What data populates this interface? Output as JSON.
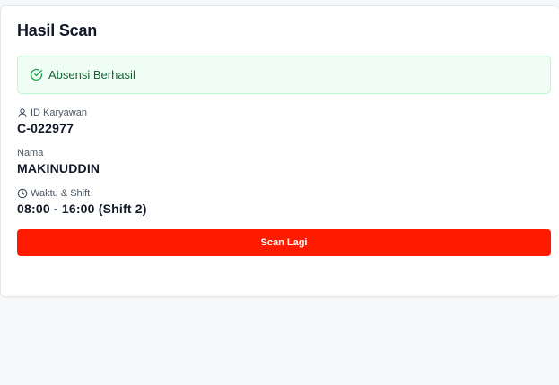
{
  "card": {
    "title": "Hasil Scan"
  },
  "alert": {
    "icon": "check-circle-icon",
    "message": "Absensi Berhasil",
    "color": "#166534",
    "background": "#f0fdf4"
  },
  "fields": {
    "id": {
      "icon": "user-icon",
      "label": "ID Karyawan",
      "value": "C-022977"
    },
    "nama": {
      "label": "Nama",
      "value": "MAKINUDDIN"
    },
    "waktu": {
      "icon": "clock-icon",
      "label": "Waktu & Shift",
      "value": "08:00 - 16:00 (Shift 2)"
    }
  },
  "actions": {
    "scan_again_label": "Scan Lagi",
    "scan_again_color": "#ff1a00"
  }
}
